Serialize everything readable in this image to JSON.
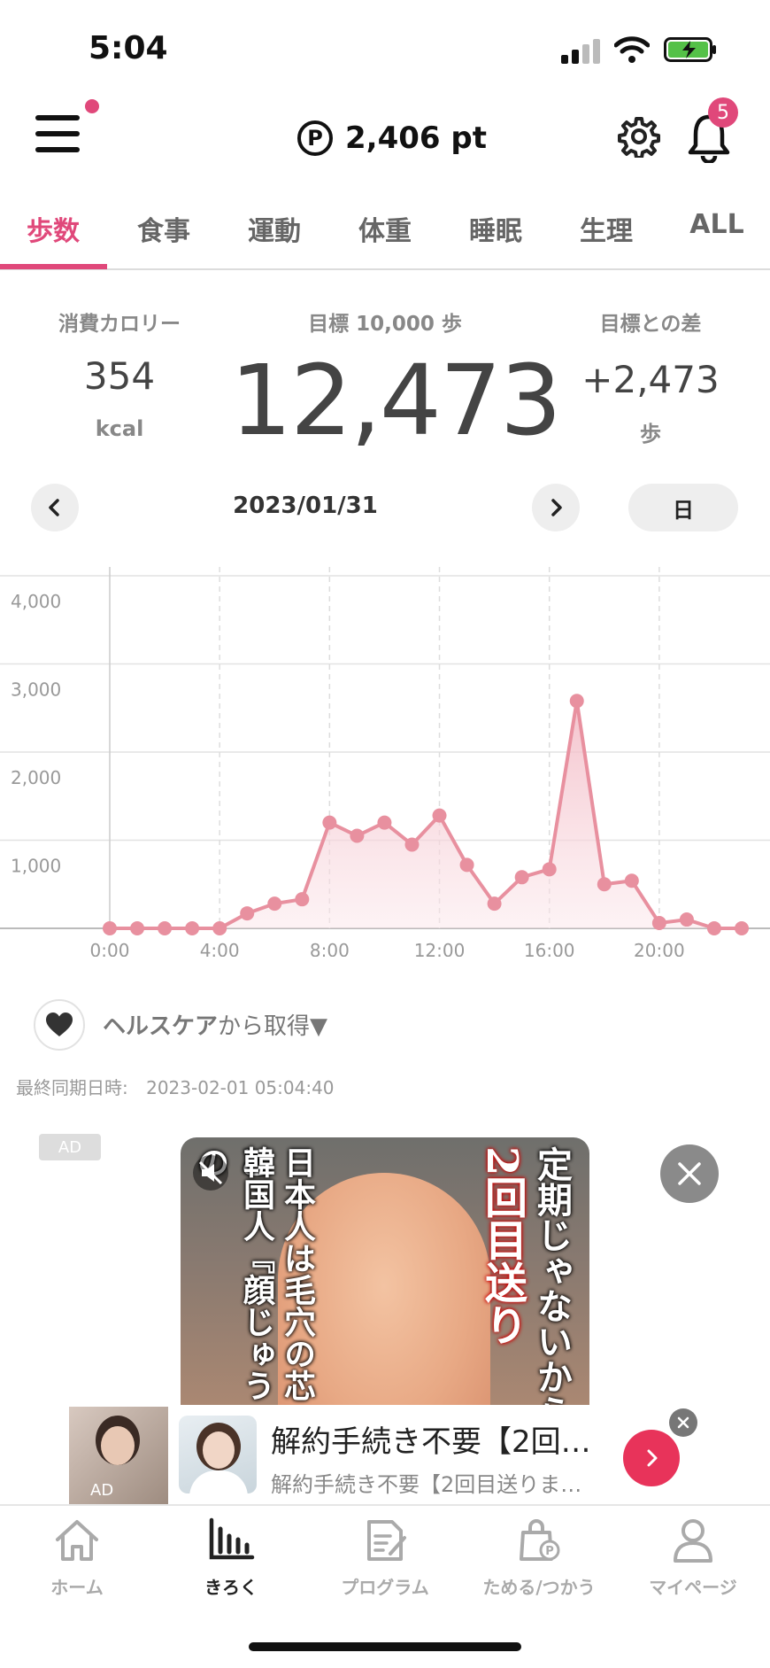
{
  "status_bar": {
    "time": "5:04"
  },
  "header": {
    "points": "2,406 pt",
    "points_symbol": "P",
    "notification_count": "5"
  },
  "tabs": [
    {
      "label": "歩数",
      "active": true
    },
    {
      "label": "食事"
    },
    {
      "label": "運動"
    },
    {
      "label": "体重"
    },
    {
      "label": "睡眠"
    },
    {
      "label": "生理"
    },
    {
      "label": "ALL"
    }
  ],
  "summary": {
    "calories_label": "消費カロリー",
    "calories_value": "354",
    "calories_unit": "kcal",
    "goal_label": "目標 10,000 歩",
    "steps": "12,473",
    "diff_label": "目標との差",
    "diff_value": "+2,473",
    "diff_unit": "歩"
  },
  "date_nav": {
    "date": "2023/01/31",
    "period": "日"
  },
  "chart_data": {
    "type": "area",
    "x": [
      "0:00",
      "1:00",
      "2:00",
      "3:00",
      "4:00",
      "5:00",
      "6:00",
      "7:00",
      "8:00",
      "9:00",
      "10:00",
      "11:00",
      "12:00",
      "13:00",
      "14:00",
      "15:00",
      "16:00",
      "17:00",
      "18:00",
      "19:00",
      "20:00",
      "21:00",
      "22:00",
      "23:00"
    ],
    "values": [
      0,
      0,
      0,
      0,
      0,
      170,
      280,
      330,
      1200,
      1050,
      1200,
      950,
      1280,
      720,
      280,
      580,
      670,
      2580,
      500,
      540,
      60,
      100,
      0,
      0
    ],
    "x_tick_labels": [
      "0:00",
      "4:00",
      "8:00",
      "12:00",
      "16:00",
      "20:00"
    ],
    "y_tick_labels": [
      "4,000",
      "3,000",
      "2,000",
      "1,000"
    ],
    "ylim": [
      0,
      4000
    ],
    "grid": true,
    "color": "#e8909f"
  },
  "healthcare": {
    "source_label": "ヘルスケア",
    "source_suffix": "から取得▼",
    "sync_label": "最終同期日時:",
    "sync_time": "2023-02-01 05:04:40"
  },
  "ad": {
    "badge": "AD",
    "video_text_right": "定期じゃないから",
    "video_text_right2": "2回目送り",
    "video_text_left": "日本人は毛穴の芯と",
    "video_text_left2": "韓国人『顔じゅうの",
    "banner_title": "解約手続き不要【2回…",
    "banner_subtitle": "解約手続き不要【2回目送りま…",
    "thumb_badge": "AD"
  },
  "bottom_nav": [
    {
      "label": "ホーム",
      "icon": "home-icon"
    },
    {
      "label": "きろく",
      "icon": "bar-chart-icon",
      "active": true
    },
    {
      "label": "プログラム",
      "icon": "document-icon"
    },
    {
      "label": "ためる/つかう",
      "icon": "shopping-bag-icon"
    },
    {
      "label": "マイページ",
      "icon": "person-icon"
    }
  ]
}
